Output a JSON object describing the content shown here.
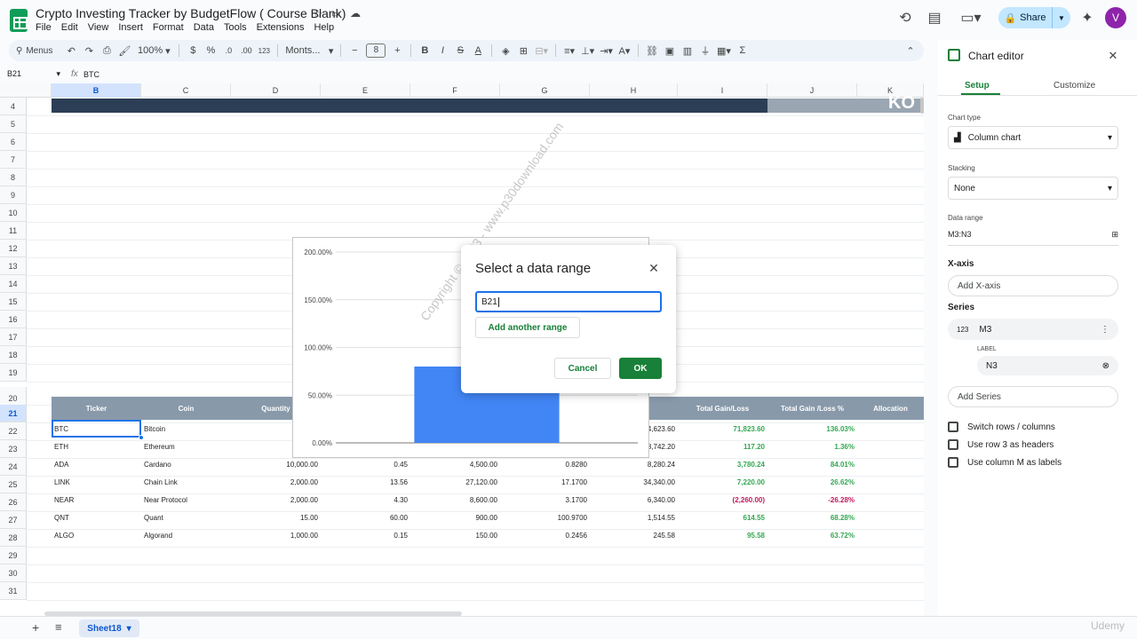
{
  "app": {
    "title": "Crypto Investing Tracker by BudgetFlow ( Course Blank)",
    "menu": [
      "File",
      "Edit",
      "View",
      "Insert",
      "Format",
      "Data",
      "Tools",
      "Extensions",
      "Help"
    ],
    "share_label": "Share",
    "avatar_letter": "V",
    "brand_color": "#0f9d58"
  },
  "toolbar": {
    "menus_label": "Menus",
    "zoom": "100%",
    "currency": "$",
    "percent": "%",
    "decrease_decimal": ".0",
    "increase_decimal": ".00",
    "number_format": "123",
    "font": "Monts...",
    "font_size": "8"
  },
  "formula_bar": {
    "cell_ref": "B21",
    "fx": "fx",
    "content": "BTC"
  },
  "grid": {
    "columns": [
      "B",
      "C",
      "D",
      "E",
      "F",
      "G",
      "H",
      "I",
      "J",
      "K"
    ],
    "selected_column": "B",
    "rows": [
      "4",
      "5",
      "6",
      "7",
      "8",
      "9",
      "10",
      "11",
      "12",
      "13",
      "14",
      "15",
      "16",
      "17",
      "18",
      "19",
      "20",
      "21",
      "22",
      "23",
      "24",
      "25",
      "26",
      "27",
      "28",
      "29",
      "30",
      "31"
    ],
    "selected_row": "21",
    "banner_text": "KO",
    "table_headers": [
      "Ticker",
      "Coin",
      "Quantity",
      "",
      "",
      "",
      "lue",
      "Total Gain/Loss",
      "Total Gain /Loss %",
      "Allocation"
    ],
    "table_rows": [
      {
        "ticker": "BTC",
        "coin": "Bitcoin",
        "qty": "",
        "e": "",
        "f": "",
        "g": "",
        "h": "24,623.60",
        "gain": "71,823.60",
        "pct": "136.03%",
        "neg": false
      },
      {
        "ticker": "ETH",
        "coin": "Ethereum",
        "qty": "",
        "e": "",
        "f": "",
        "g": "",
        "h": "8,742.20",
        "gain": "117.20",
        "pct": "1.36%",
        "neg": false
      },
      {
        "ticker": "ADA",
        "coin": "Cardano",
        "qty": "10,000.00",
        "e": "0.45",
        "f": "4,500.00",
        "g": "0.8280",
        "h": "8,280.24",
        "gain": "3,780.24",
        "pct": "84.01%",
        "neg": false
      },
      {
        "ticker": "LINK",
        "coin": "Chain Link",
        "qty": "2,000.00",
        "e": "13.56",
        "f": "27,120.00",
        "g": "17.1700",
        "h": "34,340.00",
        "gain": "7,220.00",
        "pct": "26.62%",
        "neg": false
      },
      {
        "ticker": "NEAR",
        "coin": "Near Protocol",
        "qty": "2,000.00",
        "e": "4.30",
        "f": "8,600.00",
        "g": "3.1700",
        "h": "6,340.00",
        "gain": "(2,260.00)",
        "pct": "-26.28%",
        "neg": true
      },
      {
        "ticker": "QNT",
        "coin": "Quant",
        "qty": "15.00",
        "e": "60.00",
        "f": "900.00",
        "g": "100.9700",
        "h": "1,514.55",
        "gain": "614.55",
        "pct": "68.28%",
        "neg": false
      },
      {
        "ticker": "ALGO",
        "coin": "Algorand",
        "qty": "1,000.00",
        "e": "0.15",
        "f": "150.00",
        "g": "0.2456",
        "h": "245.58",
        "gain": "95.58",
        "pct": "63.72%",
        "neg": false
      }
    ]
  },
  "chart_data": {
    "type": "bar",
    "categories": [
      ""
    ],
    "values": [
      0.8
    ],
    "ylim": [
      0,
      2
    ],
    "ytick_labels": [
      "0.00%",
      "50.00%",
      "100.00%",
      "150.00%",
      "200.00%"
    ],
    "yticks": [
      0,
      0.5,
      1.0,
      1.5,
      2.0
    ],
    "grid": true,
    "color": "#4285f4"
  },
  "dialog": {
    "title": "Select a data range",
    "input_value": "B21",
    "add_range_label": "Add another range",
    "cancel_label": "Cancel",
    "ok_label": "OK"
  },
  "watermark": "Copyright © 2023 - www.p30download.com",
  "sheet": {
    "tab_name": "Sheet18"
  },
  "chart_editor": {
    "title": "Chart editor",
    "tab_setup": "Setup",
    "tab_customize": "Customize",
    "chart_type_label": "Chart type",
    "chart_type_value": "Column chart",
    "stacking_label": "Stacking",
    "stacking_value": "None",
    "data_range_label": "Data range",
    "data_range_value": "M3:N3",
    "x_axis_heading": "X-axis",
    "add_x_axis": "Add X-axis",
    "series_heading": "Series",
    "series_name": "M3",
    "series_icon": "123",
    "label_heading": "LABEL",
    "label_value": "N3",
    "add_series": "Add Series",
    "checkboxes": [
      "Switch rows / columns",
      "Use row 3 as headers",
      "Use column M as labels"
    ]
  },
  "corner_watermark": "Udemy"
}
